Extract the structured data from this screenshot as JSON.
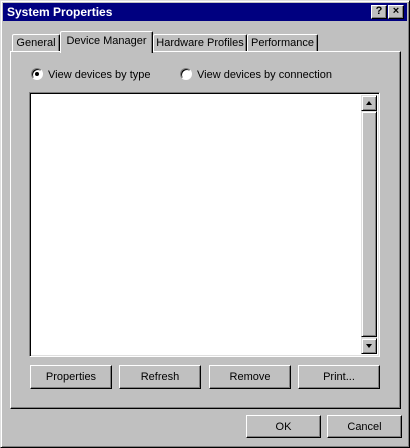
{
  "window": {
    "title": "System Properties",
    "help_label": "?",
    "close_label": "×"
  },
  "tabs": [
    {
      "label": "General",
      "active": false
    },
    {
      "label": "Device Manager",
      "active": true
    },
    {
      "label": "Hardware Profiles",
      "active": false
    },
    {
      "label": "Performance",
      "active": false
    }
  ],
  "view_options": {
    "by_type": {
      "label": "View devices by type",
      "checked": true
    },
    "by_connection": {
      "label": "View devices by connection",
      "checked": false
    }
  },
  "device_list": {
    "items": []
  },
  "device_buttons": {
    "properties": "Properties",
    "refresh": "Refresh",
    "remove": "Remove",
    "print": "Print..."
  },
  "dialog_buttons": {
    "ok": "OK",
    "cancel": "Cancel"
  },
  "colors": {
    "face": "#c0c0c0",
    "title_bar": "#000080",
    "title_text": "#ffffff"
  }
}
